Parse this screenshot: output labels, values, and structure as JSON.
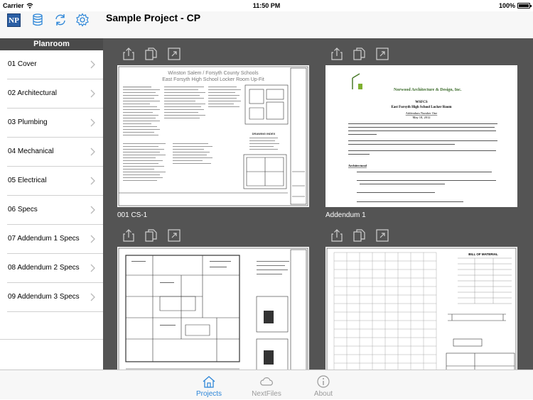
{
  "status_bar": {
    "carrier": "Carrier",
    "time": "11:50 PM",
    "battery": "100%"
  },
  "nav": {
    "logo_text": "NP",
    "title": "Sample Project - CP",
    "icons": [
      "logo-icon",
      "database-icon",
      "refresh-icon",
      "settings-gear-icon"
    ],
    "accent_color": "#2d86d8"
  },
  "sidebar": {
    "header": "Planroom",
    "items": [
      {
        "label": "01 Cover"
      },
      {
        "label": "02 Architectural"
      },
      {
        "label": "03 Plumbing"
      },
      {
        "label": "04 Mechanical"
      },
      {
        "label": "05 Electrical"
      },
      {
        "label": "06 Specs"
      },
      {
        "label": "07 Addendum 1 Specs"
      },
      {
        "label": "08 Addendum 2 Specs"
      },
      {
        "label": "09 Addendum 3 Specs"
      }
    ]
  },
  "tiles": [
    {
      "label": "001 CS-1",
      "header_line1": "Winston Salem / Forsyth County Schools",
      "header_line2": "East Forsyth High School Locker Room Up-Fit",
      "drawing_index": "DRAWING INDEX"
    },
    {
      "label": "Addendum 1",
      "firm": "Norwood Architecture & Design, Inc.",
      "org": "WSFCS",
      "subject": "East Forsyth High School Locker Room",
      "addendum_no": "Addendum Number One",
      "date": "May 18, 2012",
      "section": "Architectural"
    },
    {
      "label": ""
    },
    {
      "label": "",
      "table_title": "BILL OF MATERIAL"
    }
  ],
  "tile_actions": [
    "share-icon",
    "copy-icon",
    "expand-icon"
  ],
  "tabbar": {
    "tabs": [
      {
        "label": "Projects",
        "icon": "house-icon",
        "active": true
      },
      {
        "label": "NextFiles",
        "icon": "cloud-icon",
        "active": false
      },
      {
        "label": "About",
        "icon": "info-icon",
        "active": false
      }
    ]
  }
}
